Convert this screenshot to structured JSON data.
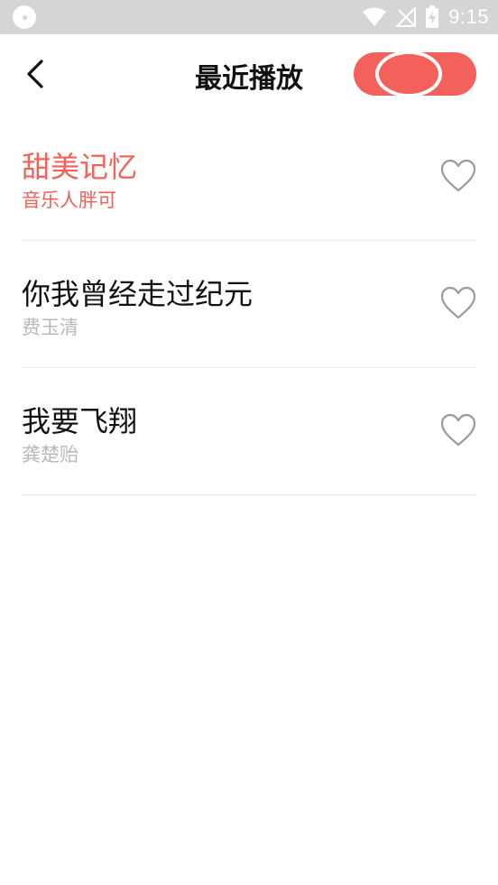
{
  "status_bar": {
    "time": "9:15",
    "icons": [
      "app-notification-icon",
      "wifi-icon",
      "no-signal-icon",
      "battery-charging-icon"
    ]
  },
  "header": {
    "title": "最近播放",
    "back_icon": "chevron-left-icon",
    "play_indicator_icon": "now-playing-icon",
    "accent_color": "#f4605a"
  },
  "songs": [
    {
      "title": "甜美记忆",
      "artist": "音乐人胖可",
      "active": true
    },
    {
      "title": "你我曾经走过纪元",
      "artist": "费玉清",
      "active": false
    },
    {
      "title": "我要飞翔",
      "artist": "龚楚贻",
      "active": false
    }
  ],
  "colors": {
    "status_bar_bg": "#d5d5d5",
    "active_text": "#f4605a",
    "secondary_text": "#b8b8b8",
    "divider": "#ececec"
  }
}
